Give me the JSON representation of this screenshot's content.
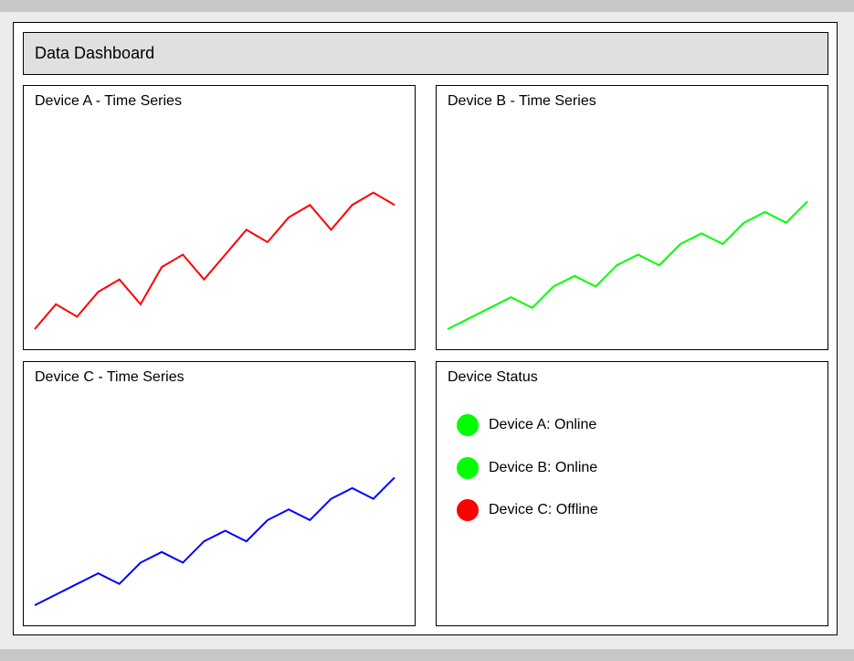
{
  "header": {
    "title": "Data Dashboard"
  },
  "panels": [
    {
      "key": "a",
      "title": "Device A - Time Series",
      "color": "#ff0000",
      "chart_data": {
        "type": "line",
        "series": [
          {
            "values": [
              0,
              2,
              1,
              3,
              4,
              2,
              5,
              6,
              4,
              6,
              8,
              7,
              9,
              10,
              8,
              10,
              11,
              10
            ]
          }
        ],
        "ylim": [
          0,
          12
        ]
      }
    },
    {
      "key": "b",
      "title": "Device B - Time Series",
      "color": "#00ff00",
      "chart_data": {
        "type": "line",
        "series": [
          {
            "values": [
              0,
              1,
              2,
              3,
              2,
              4,
              5,
              4,
              6,
              7,
              6,
              8,
              9,
              8,
              10,
              11,
              10,
              12
            ]
          }
        ],
        "ylim": [
          0,
          14
        ]
      }
    },
    {
      "key": "c",
      "title": "Device C - Time Series",
      "color": "#0000ff",
      "chart_data": {
        "type": "line",
        "series": [
          {
            "values": [
              0,
              1,
              2,
              3,
              2,
              4,
              5,
              4,
              6,
              7,
              6,
              8,
              9,
              8,
              10,
              11,
              10,
              12
            ]
          }
        ],
        "ylim": [
          0,
          14
        ]
      }
    }
  ],
  "status": {
    "title": "Device Status",
    "items": [
      {
        "label": "Device A: Online",
        "color": "#00ff00"
      },
      {
        "label": "Device B: Online",
        "color": "#00ff00"
      },
      {
        "label": "Device C: Offline",
        "color": "#ff0000"
      }
    ]
  }
}
